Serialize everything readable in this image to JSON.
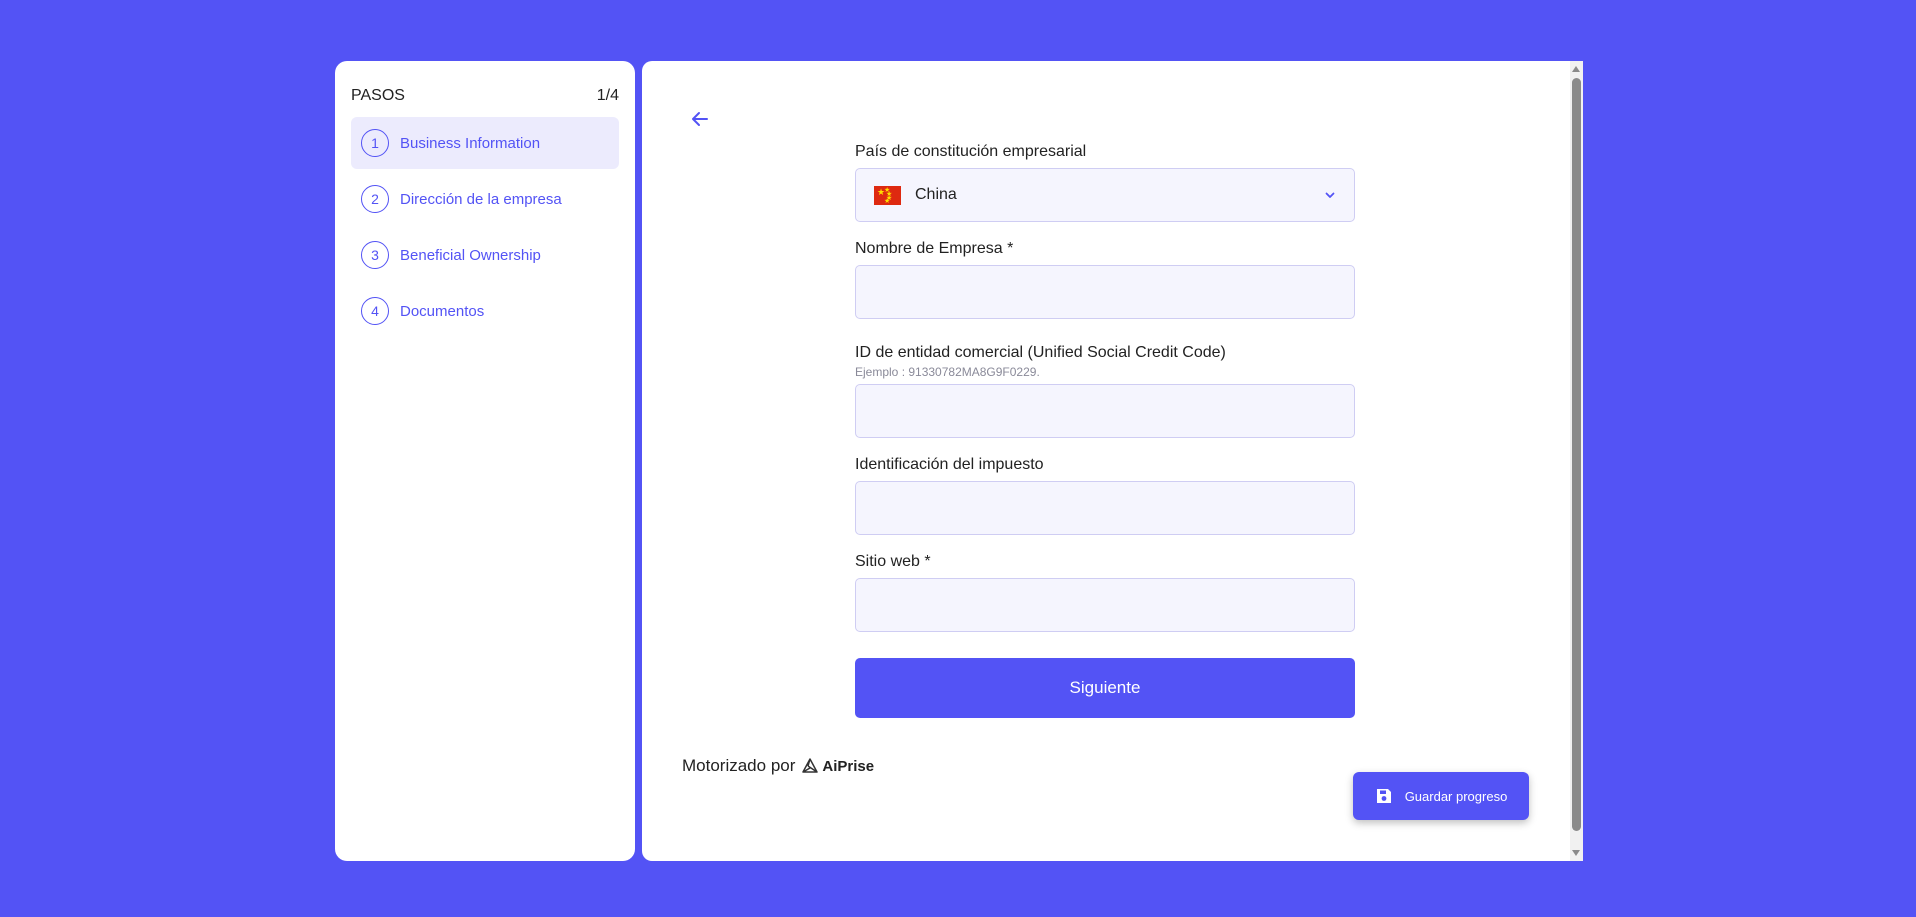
{
  "sidebar": {
    "title": "PASOS",
    "progress": "1/4",
    "steps": [
      {
        "num": "1",
        "label": "Business Information"
      },
      {
        "num": "2",
        "label": "Dirección de la empresa"
      },
      {
        "num": "3",
        "label": "Beneficial Ownership"
      },
      {
        "num": "4",
        "label": "Documentos"
      }
    ]
  },
  "form": {
    "country_label": "País de constitución empresarial",
    "country_value": "China",
    "company_name_label": "Nombre de Empresa *",
    "company_name_value": "",
    "entity_id_label": "ID de entidad comercial (Unified Social Credit Code)",
    "entity_id_hint": "Ejemplo : 91330782MA8G9F0229.",
    "entity_id_value": "",
    "tax_id_label": "Identificación del impuesto",
    "tax_id_value": "",
    "website_label": "Sitio web *",
    "website_value": "",
    "next_label": "Siguiente"
  },
  "footer": {
    "powered_label": "Motorizado por",
    "brand": "AiPrise"
  },
  "save_label": "Guardar progreso",
  "colors": {
    "accent": "#5353f5",
    "active_step_bg": "#ecebfd",
    "field_bg": "#f5f5fe"
  }
}
